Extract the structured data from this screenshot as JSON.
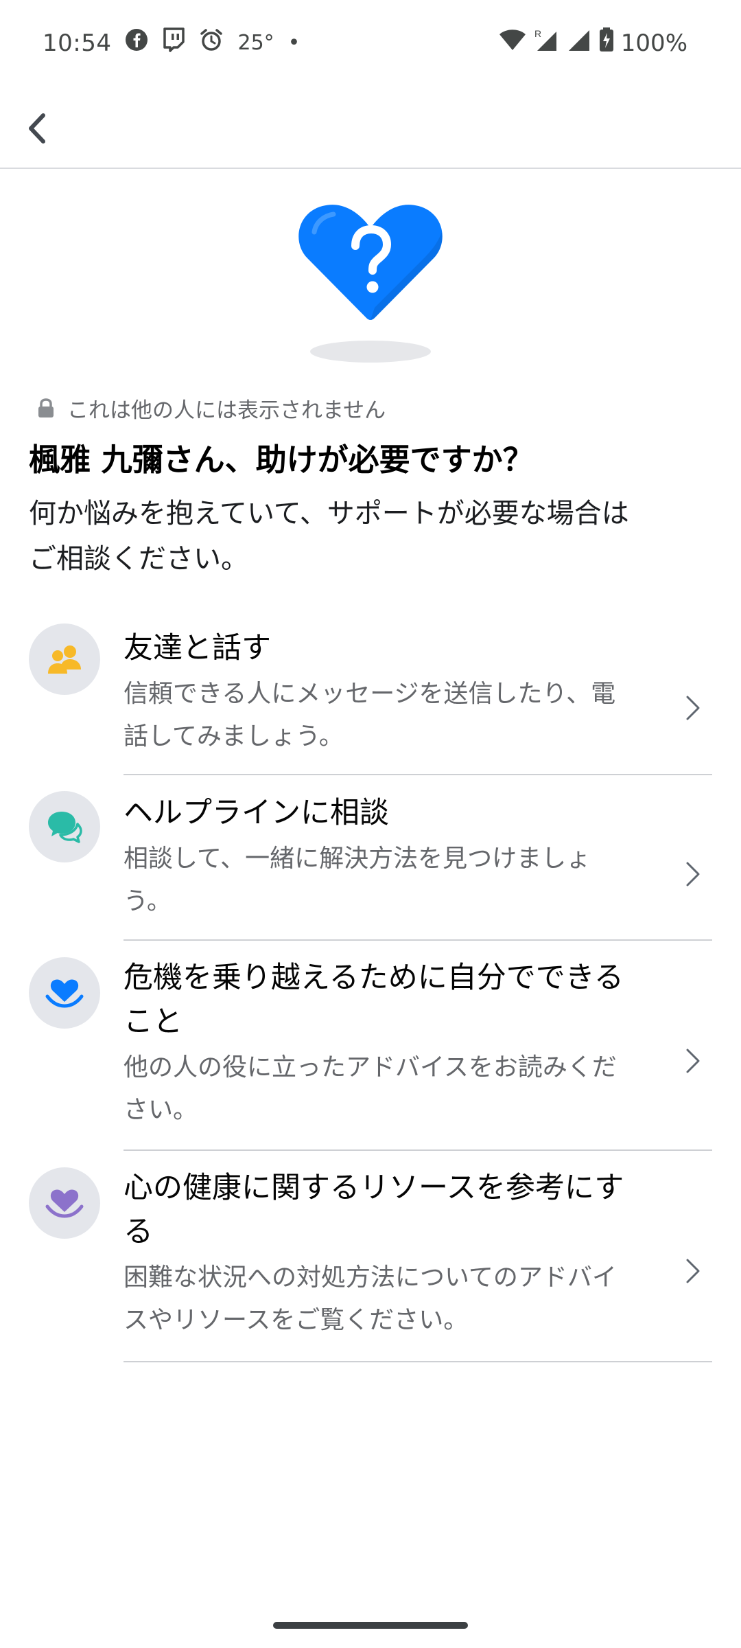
{
  "status_bar": {
    "time": "10:54",
    "temperature": "25°",
    "dot": "•",
    "battery": "100%",
    "left_icons": [
      "facebook-icon",
      "twitch-icon",
      "alarm-icon"
    ],
    "right_icons": [
      "wifi-icon",
      "signal-roaming-icon",
      "signal-icon",
      "battery-charging-icon"
    ]
  },
  "app_bar": {
    "back_icon": "back-arrow-icon"
  },
  "hero": {
    "icon": "question-heart-icon",
    "colors": {
      "heart": "#0a7cff",
      "heart_dark": "#0866d6",
      "shadow": "#e6e7ea"
    }
  },
  "privacy_note": {
    "icon": "lock-icon",
    "text": "これは他の人には表示されません"
  },
  "title": "楓雅 九彌さん、助けが必要ですか？",
  "subtitle_line1": "何か悩みを抱えていて、サポートが必要な場合は",
  "subtitle_line2": "ご相談ください。",
  "options": [
    {
      "icon": "friends-icon",
      "icon_color": "#f7b928",
      "title_line1": "友達と話す",
      "desc_line1": "信頼できる人にメッセージを送信したり、電",
      "desc_line2": "話してみましょう。"
    },
    {
      "icon": "chat-bubbles-icon",
      "icon_color": "#2abba7",
      "title_line1": "ヘルプラインに相談",
      "desc_line1": "相談して、一緒に解決方法を見つけましょ",
      "desc_line2": "う。"
    },
    {
      "icon": "heart-in-hands-icon",
      "icon_color": "#0a7cff",
      "title_line1": "危機を乗り越えるために自分でできる",
      "title_line2": "こと",
      "desc_line1": "他の人の役に立ったアドバイスをお読みくだ",
      "desc_line2": "さい。"
    },
    {
      "icon": "heart-in-hands-icon",
      "icon_color": "#8c72cb",
      "title_line1": "心の健康に関するリソースを参考にす",
      "title_line2": "る",
      "desc_line1": "困難な状況への対処方法についてのアドバイ",
      "desc_line2": "スやリソースをご覧ください。"
    }
  ]
}
